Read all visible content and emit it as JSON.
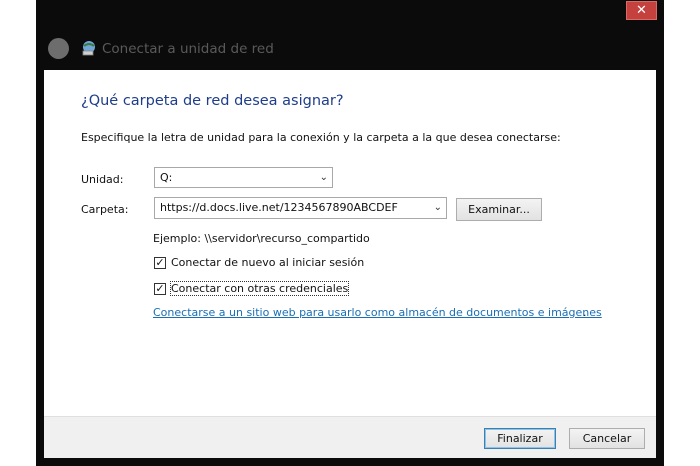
{
  "window": {
    "title": "Conectar a unidad de red",
    "close_glyph": "✕"
  },
  "dialog": {
    "heading": "¿Qué carpeta de red desea asignar?",
    "instructions": "Especifique la letra de unidad para la conexión y la carpeta a la que desea conectarse:",
    "drive": {
      "label": "Unidad:",
      "value": "Q:"
    },
    "folder": {
      "label": "Carpeta:",
      "value": "https://d.docs.live.net/1234567890ABCDEF"
    },
    "browse_button": "Examinar...",
    "example": "Ejemplo: \\\\servidor\\recurso_compartido",
    "reconnect": {
      "label": "Conectar de nuevo al iniciar sesión",
      "checked": true
    },
    "other_credentials": {
      "label": "Conectar con otras credenciales",
      "checked": true
    },
    "link": "Conectarse a un sitio web para usarlo como almacén de documentos e imágenes",
    "link_suffix": "."
  },
  "footer": {
    "finish_button": "Finalizar",
    "cancel_button": "Cancelar"
  },
  "icons": {
    "back": "back-arrow-icon",
    "network": "network-drive-icon",
    "dropdown": "chevron-down-icon",
    "checkmark": "checkmark-icon"
  },
  "colors": {
    "heading": "#1e3d8a",
    "link": "#1a6fb4",
    "close_button": "#c4413d",
    "frame": "#0b0b0b"
  }
}
